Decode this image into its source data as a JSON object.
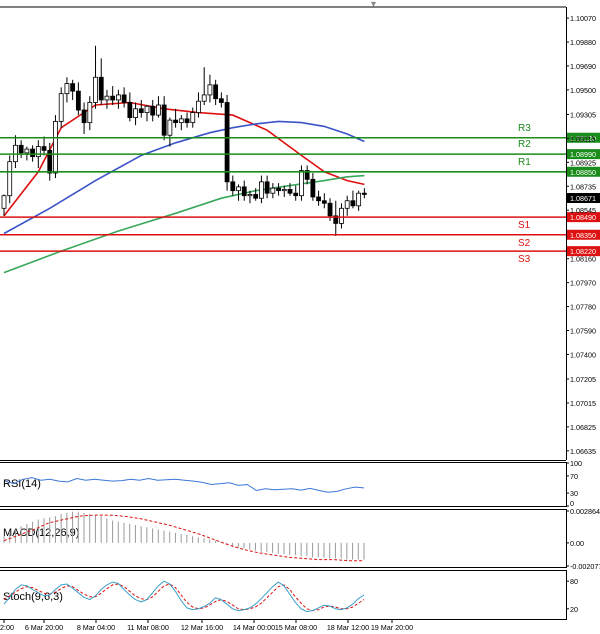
{
  "chart_data": {
    "type": "candlestick",
    "symbol": "EURUSD",
    "timeframe": "H4",
    "x_labels": [
      "2:00",
      "6 Mar 20:00",
      "8 Mar 04:00",
      "11 Mar 08:00",
      "12 Mar 16:00",
      "14 Mar 00:00",
      "15 Mar 08:00",
      "18 Mar 12:00",
      "19 Mar 20:00"
    ],
    "price_ticks": [
      "1.10070",
      "1.09880",
      "1.09690",
      "1.09500",
      "1.09305",
      "1.09115",
      "1.08925",
      "1.08735",
      "1.08545",
      "1.08160",
      "1.07970",
      "1.07780",
      "1.07590",
      "1.07400",
      "1.07205",
      "1.07015",
      "1.06825",
      "1.06635"
    ],
    "ylim": [
      1.0657,
      1.1015
    ],
    "current_price": "1.08671",
    "levels": [
      {
        "name": "R3",
        "value": 1.0912,
        "label": "1.09120",
        "color": "#1a8c1a"
      },
      {
        "name": "R2",
        "value": 1.0899,
        "label": "1.08990",
        "color": "#1a8c1a"
      },
      {
        "name": "R1",
        "value": 1.0885,
        "label": "1.08850",
        "color": "#1a8c1a"
      },
      {
        "name": "S1",
        "value": 1.0849,
        "label": "1.08490",
        "color": "#dd1111"
      },
      {
        "name": "S2",
        "value": 1.0835,
        "label": "1.08350",
        "color": "#dd1111"
      },
      {
        "name": "S3",
        "value": 1.0822,
        "label": "1.08220",
        "color": "#dd1111"
      }
    ],
    "candles": [
      {
        "o": 1.0856,
        "h": 1.0867,
        "l": 1.085,
        "c": 1.0866
      },
      {
        "o": 1.0866,
        "h": 1.0898,
        "l": 1.086,
        "c": 1.0893
      },
      {
        "o": 1.0893,
        "h": 1.0914,
        "l": 1.0888,
        "c": 1.0906
      },
      {
        "o": 1.0906,
        "h": 1.091,
        "l": 1.0896,
        "c": 1.09
      },
      {
        "o": 1.09,
        "h": 1.0905,
        "l": 1.0894,
        "c": 1.0903
      },
      {
        "o": 1.0903,
        "h": 1.0906,
        "l": 1.0893,
        "c": 1.0897
      },
      {
        "o": 1.0897,
        "h": 1.091,
        "l": 1.0888,
        "c": 1.0905
      },
      {
        "o": 1.0905,
        "h": 1.0913,
        "l": 1.0898,
        "c": 1.0902
      },
      {
        "o": 1.0902,
        "h": 1.0908,
        "l": 1.0878,
        "c": 1.0884
      },
      {
        "o": 1.0884,
        "h": 1.093,
        "l": 1.088,
        "c": 1.0925
      },
      {
        "o": 1.0925,
        "h": 1.0952,
        "l": 1.092,
        "c": 1.0947
      },
      {
        "o": 1.0947,
        "h": 1.096,
        "l": 1.094,
        "c": 1.0955
      },
      {
        "o": 1.0955,
        "h": 1.0958,
        "l": 1.0942,
        "c": 1.0949
      },
      {
        "o": 1.0949,
        "h": 1.0956,
        "l": 1.093,
        "c": 1.0934
      },
      {
        "o": 1.0934,
        "h": 1.094,
        "l": 1.0915,
        "c": 1.0924
      },
      {
        "o": 1.0924,
        "h": 1.0945,
        "l": 1.0918,
        "c": 1.094
      },
      {
        "o": 1.094,
        "h": 1.0985,
        "l": 1.0935,
        "c": 1.096
      },
      {
        "o": 1.096,
        "h": 1.0975,
        "l": 1.0938,
        "c": 1.0942
      },
      {
        "o": 1.0942,
        "h": 1.095,
        "l": 1.0935,
        "c": 1.0945
      },
      {
        "o": 1.0945,
        "h": 1.0953,
        "l": 1.0938,
        "c": 1.0942
      },
      {
        "o": 1.0942,
        "h": 1.095,
        "l": 1.0935,
        "c": 1.0946
      },
      {
        "o": 1.0946,
        "h": 1.0952,
        "l": 1.0936,
        "c": 1.094
      },
      {
        "o": 1.094,
        "h": 1.0948,
        "l": 1.0925,
        "c": 1.0928
      },
      {
        "o": 1.0928,
        "h": 1.094,
        "l": 1.0922,
        "c": 1.0935
      },
      {
        "o": 1.0935,
        "h": 1.0942,
        "l": 1.0928,
        "c": 1.0932
      },
      {
        "o": 1.0932,
        "h": 1.0938,
        "l": 1.0925,
        "c": 1.0937
      },
      {
        "o": 1.0937,
        "h": 1.0942,
        "l": 1.0925,
        "c": 1.093
      },
      {
        "o": 1.093,
        "h": 1.0945,
        "l": 1.0928,
        "c": 1.0938
      },
      {
        "o": 1.0938,
        "h": 1.0945,
        "l": 1.091,
        "c": 1.0914
      },
      {
        "o": 1.0914,
        "h": 1.0928,
        "l": 1.0905,
        "c": 1.0926
      },
      {
        "o": 1.0926,
        "h": 1.0935,
        "l": 1.092,
        "c": 1.0924
      },
      {
        "o": 1.0924,
        "h": 1.093,
        "l": 1.0918,
        "c": 1.0927
      },
      {
        "o": 1.0927,
        "h": 1.0932,
        "l": 1.092,
        "c": 1.0924
      },
      {
        "o": 1.0924,
        "h": 1.0936,
        "l": 1.092,
        "c": 1.0932
      },
      {
        "o": 1.0932,
        "h": 1.0948,
        "l": 1.0928,
        "c": 1.0941
      },
      {
        "o": 1.0941,
        "h": 1.0968,
        "l": 1.0938,
        "c": 1.0946
      },
      {
        "o": 1.0946,
        "h": 1.0962,
        "l": 1.094,
        "c": 1.0954
      },
      {
        "o": 1.0954,
        "h": 1.0958,
        "l": 1.0938,
        "c": 1.0943
      },
      {
        "o": 1.0943,
        "h": 1.0948,
        "l": 1.0936,
        "c": 1.094
      },
      {
        "o": 1.094,
        "h": 1.0946,
        "l": 1.087,
        "c": 1.0877
      },
      {
        "o": 1.0877,
        "h": 1.0882,
        "l": 1.0866,
        "c": 1.087
      },
      {
        "o": 1.087,
        "h": 1.0875,
        "l": 1.0862,
        "c": 1.0873
      },
      {
        "o": 1.0873,
        "h": 1.0878,
        "l": 1.0862,
        "c": 1.0866
      },
      {
        "o": 1.0866,
        "h": 1.087,
        "l": 1.086,
        "c": 1.0867
      },
      {
        "o": 1.0867,
        "h": 1.0872,
        "l": 1.0862,
        "c": 1.0864
      },
      {
        "o": 1.0864,
        "h": 1.0882,
        "l": 1.086,
        "c": 1.0877
      },
      {
        "o": 1.0877,
        "h": 1.0882,
        "l": 1.0864,
        "c": 1.0868
      },
      {
        "o": 1.0868,
        "h": 1.0876,
        "l": 1.0864,
        "c": 1.0872
      },
      {
        "o": 1.0872,
        "h": 1.0876,
        "l": 1.0866,
        "c": 1.087
      },
      {
        "o": 1.087,
        "h": 1.0874,
        "l": 1.0865,
        "c": 1.0871
      },
      {
        "o": 1.0871,
        "h": 1.0876,
        "l": 1.0866,
        "c": 1.0868
      },
      {
        "o": 1.0868,
        "h": 1.0874,
        "l": 1.0862,
        "c": 1.0866
      },
      {
        "o": 1.0866,
        "h": 1.089,
        "l": 1.0862,
        "c": 1.0886
      },
      {
        "o": 1.0886,
        "h": 1.089,
        "l": 1.0875,
        "c": 1.0879
      },
      {
        "o": 1.0879,
        "h": 1.0884,
        "l": 1.0862,
        "c": 1.0865
      },
      {
        "o": 1.0865,
        "h": 1.087,
        "l": 1.0858,
        "c": 1.0862
      },
      {
        "o": 1.0862,
        "h": 1.0868,
        "l": 1.0856,
        "c": 1.086
      },
      {
        "o": 1.086,
        "h": 1.0864,
        "l": 1.0846,
        "c": 1.085
      },
      {
        "o": 1.085,
        "h": 1.0862,
        "l": 1.0834,
        "c": 1.0844
      },
      {
        "o": 1.0844,
        "h": 1.086,
        "l": 1.084,
        "c": 1.0856
      },
      {
        "o": 1.0856,
        "h": 1.0866,
        "l": 1.085,
        "c": 1.0862
      },
      {
        "o": 1.0862,
        "h": 1.087,
        "l": 1.0856,
        "c": 1.0858
      },
      {
        "o": 1.0858,
        "h": 1.087,
        "l": 1.0854,
        "c": 1.0868
      },
      {
        "o": 1.0868,
        "h": 1.0872,
        "l": 1.0864,
        "c": 1.0867
      }
    ],
    "ma_series": [
      {
        "color": "#dd1111",
        "x": [
          0,
          6,
          10,
          16,
          22,
          28,
          34,
          40,
          46,
          52,
          56,
          60,
          63
        ],
        "values": [
          1.085,
          1.0885,
          1.092,
          1.0938,
          1.094,
          1.0935,
          1.0932,
          1.093,
          1.0918,
          1.0898,
          1.0885,
          1.0878,
          1.0875
        ]
      },
      {
        "color": "#3a54c8",
        "x": [
          0,
          8,
          16,
          24,
          30,
          36,
          40,
          44,
          48,
          52,
          56,
          60,
          63
        ],
        "values": [
          1.0836,
          1.0856,
          1.0878,
          1.0898,
          1.0908,
          1.0916,
          1.092,
          1.0923,
          1.0925,
          1.0924,
          1.0921,
          1.0915,
          1.0909
        ]
      },
      {
        "color": "#3aa85c",
        "x": [
          0,
          10,
          20,
          30,
          38,
          44,
          50,
          56,
          60,
          63
        ],
        "values": [
          1.0805,
          1.0822,
          1.0838,
          1.0852,
          1.0864,
          1.087,
          1.0874,
          1.0878,
          1.0881,
          1.0882
        ]
      }
    ],
    "rsi": {
      "label": "RSI(14)",
      "ticks": [
        "100",
        "70",
        "30",
        "0"
      ],
      "values": [
        58,
        52,
        62,
        66,
        60,
        62,
        58,
        56,
        64,
        60,
        62,
        60,
        58,
        59,
        62,
        60,
        64,
        60,
        61,
        62,
        60,
        58,
        55,
        50,
        52,
        54,
        48,
        50,
        36,
        40,
        38,
        39,
        40,
        37,
        41,
        36,
        32,
        34,
        40,
        44,
        42
      ]
    },
    "macd": {
      "label": "MACD(12,26,9)",
      "ticks": [
        "0.002864",
        "0.00",
        "-0.002077"
      ],
      "ylim": [
        -0.002077,
        0.002864
      ],
      "histogram": [
        0.0006,
        0.0009,
        0.0012,
        0.0015,
        0.0017,
        0.0019,
        0.0021,
        0.0022,
        0.0023,
        0.0024,
        0.0026,
        0.0027,
        0.0028,
        0.0028,
        0.0027,
        0.0026,
        0.0025,
        0.0024,
        0.0022,
        0.002,
        0.0019,
        0.0018,
        0.0017,
        0.0016,
        0.0015,
        0.0014,
        0.0013,
        0.0012,
        0.0011,
        0.001,
        0.0009,
        0.0008,
        0.0007,
        0.0006,
        0.0005,
        0.0004,
        0.0003,
        0.0002,
        0.0001,
        -0.0001,
        -0.0003,
        -0.0004,
        -0.0005,
        -0.0006,
        -0.0007,
        -0.0008,
        -0.0008,
        -0.0009,
        -0.001,
        -0.001,
        -0.0011,
        -0.0011,
        -0.0012,
        -0.0012,
        -0.0013,
        -0.0013,
        -0.0013,
        -0.0014,
        -0.0014,
        -0.0014,
        -0.0015,
        -0.0015,
        -0.0015,
        -0.0015
      ],
      "signal": [
        0.0002,
        0.0007,
        0.0012,
        0.0018,
        0.0021,
        0.0024,
        0.0025,
        0.0025,
        0.0024,
        0.0022,
        0.0019,
        0.0016,
        0.0012,
        0.0008,
        0.0003,
        -0.0002,
        -0.0006,
        -0.0009,
        -0.0011,
        -0.0013,
        -0.0014,
        -0.0015,
        -0.0015,
        -0.0016,
        -0.0016
      ]
    },
    "stoch": {
      "label": "Stoch(9,6,3)",
      "ticks": [
        "80",
        "20"
      ],
      "main": [
        30,
        45,
        62,
        72,
        70,
        62,
        55,
        48,
        50,
        62,
        72,
        74,
        65,
        55,
        45,
        40,
        48,
        62,
        72,
        78,
        75,
        62,
        50,
        40,
        35,
        40,
        55,
        70,
        80,
        74,
        58,
        38,
        22,
        18,
        20,
        25,
        32,
        44,
        40,
        30,
        20,
        16,
        18,
        22,
        30,
        42,
        55,
        68,
        78,
        70,
        52,
        34,
        20,
        14,
        16,
        22,
        28,
        26,
        20,
        18,
        22,
        30,
        42,
        50
      ],
      "signal": [
        40,
        48,
        56,
        64,
        68,
        66,
        60,
        54,
        52,
        56,
        64,
        70,
        68,
        60,
        52,
        46,
        46,
        54,
        64,
        72,
        74,
        68,
        58,
        48,
        42,
        40,
        46,
        58,
        70,
        74,
        66,
        50,
        34,
        24,
        20,
        22,
        28,
        36,
        40,
        36,
        28,
        20,
        18,
        20,
        24,
        32,
        44,
        56,
        68,
        72,
        62,
        46,
        32,
        20,
        16,
        18,
        24,
        26,
        24,
        20,
        20,
        24,
        32,
        40
      ]
    }
  }
}
